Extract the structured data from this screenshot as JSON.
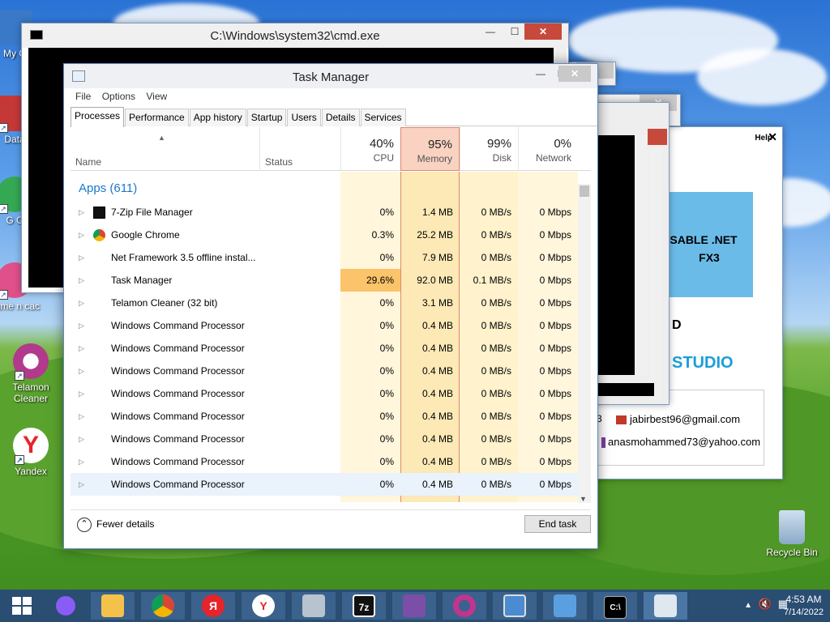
{
  "desktop": {
    "icons": [
      {
        "label": "My C",
        "color": "#3a79c8"
      },
      {
        "label": "Data",
        "color": "#c43838"
      },
      {
        "label": "G C",
        "color": "#34a853"
      },
      {
        "label": "game n cac",
        "color": "#e0508a"
      },
      {
        "label": "Telamon Cleaner",
        "color": "#b23a8c"
      },
      {
        "label": "Yandex",
        "color": "#ffffff"
      },
      {
        "label": "Recycle Bin",
        "color": "#9fb8d2"
      }
    ]
  },
  "cmd_window": {
    "title": "C:\\Windows\\system32\\cmd.exe"
  },
  "side_window": {
    "help_label": "Help",
    "banner_line1": "SABLE .NET",
    "banner_line2": "FX3",
    "letter_d": "D",
    "studio_text": "STUDIO",
    "contact_fragment": "3",
    "email1": "jabirbest96@gmail.com",
    "email2": "anasmohammed73@yahoo.com"
  },
  "task_manager": {
    "title": "Task Manager",
    "menu": [
      "File",
      "Options",
      "View"
    ],
    "tabs": [
      "Processes",
      "Performance",
      "App history",
      "Startup",
      "Users",
      "Details",
      "Services"
    ],
    "columns": {
      "name": "Name",
      "status": "Status",
      "cpu_pct": "40%",
      "cpu": "CPU",
      "memory_pct": "95%",
      "memory": "Memory",
      "disk_pct": "99%",
      "disk": "Disk",
      "network_pct": "0%",
      "network": "Network"
    },
    "group_label": "Apps (611)",
    "processes": [
      {
        "name": "7-Zip File Manager",
        "icon": "7zip-icon",
        "cpu": "0%",
        "memory": "1.4 MB",
        "disk": "0 MB/s",
        "network": "0 Mbps"
      },
      {
        "name": "Google Chrome",
        "icon": "chrome-icon",
        "cpu": "0.3%",
        "memory": "25.2 MB",
        "disk": "0 MB/s",
        "network": "0 Mbps"
      },
      {
        "name": "Net Framework 3.5 offline instal...",
        "icon": "",
        "cpu": "0%",
        "memory": "7.9 MB",
        "disk": "0 MB/s",
        "network": "0 Mbps"
      },
      {
        "name": "Task Manager",
        "icon": "",
        "cpu": "29.6%",
        "memory": "92.0 MB",
        "disk": "0.1 MB/s",
        "network": "0 Mbps"
      },
      {
        "name": "Telamon Cleaner (32 bit)",
        "icon": "",
        "cpu": "0%",
        "memory": "3.1 MB",
        "disk": "0 MB/s",
        "network": "0 Mbps"
      },
      {
        "name": "Windows Command Processor",
        "icon": "",
        "cpu": "0%",
        "memory": "0.4 MB",
        "disk": "0 MB/s",
        "network": "0 Mbps"
      },
      {
        "name": "Windows Command Processor",
        "icon": "",
        "cpu": "0%",
        "memory": "0.4 MB",
        "disk": "0 MB/s",
        "network": "0 Mbps"
      },
      {
        "name": "Windows Command Processor",
        "icon": "",
        "cpu": "0%",
        "memory": "0.4 MB",
        "disk": "0 MB/s",
        "network": "0 Mbps"
      },
      {
        "name": "Windows Command Processor",
        "icon": "",
        "cpu": "0%",
        "memory": "0.4 MB",
        "disk": "0 MB/s",
        "network": "0 Mbps"
      },
      {
        "name": "Windows Command Processor",
        "icon": "",
        "cpu": "0%",
        "memory": "0.4 MB",
        "disk": "0 MB/s",
        "network": "0 Mbps"
      },
      {
        "name": "Windows Command Processor",
        "icon": "",
        "cpu": "0%",
        "memory": "0.4 MB",
        "disk": "0 MB/s",
        "network": "0 Mbps"
      },
      {
        "name": "Windows Command Processor",
        "icon": "",
        "cpu": "0%",
        "memory": "0.4 MB",
        "disk": "0 MB/s",
        "network": "0 Mbps"
      },
      {
        "name": "Windows Command Processor",
        "icon": "",
        "cpu": "0%",
        "memory": "0.4 MB",
        "disk": "0 MB/s",
        "network": "0 Mbps"
      }
    ],
    "fewer_details": "Fewer details",
    "end_task": "End task"
  },
  "taskbar": {
    "items": [
      "start",
      "alice",
      "file-explorer",
      "chrome",
      "yandex-browser-red",
      "yandex",
      "installer",
      "7zip",
      "net-installer",
      "telamon",
      "photos",
      "control-panel",
      "cmd",
      "task-manager"
    ],
    "time": "4:53 AM",
    "date": "7/14/2022"
  },
  "colors": {
    "accent": "#1979ca",
    "memory_header": "#f9d2c2",
    "cpu_heat": "#fde7b2",
    "cpu_hot": "#fbc36a",
    "taskbar": "#2a4d72"
  }
}
